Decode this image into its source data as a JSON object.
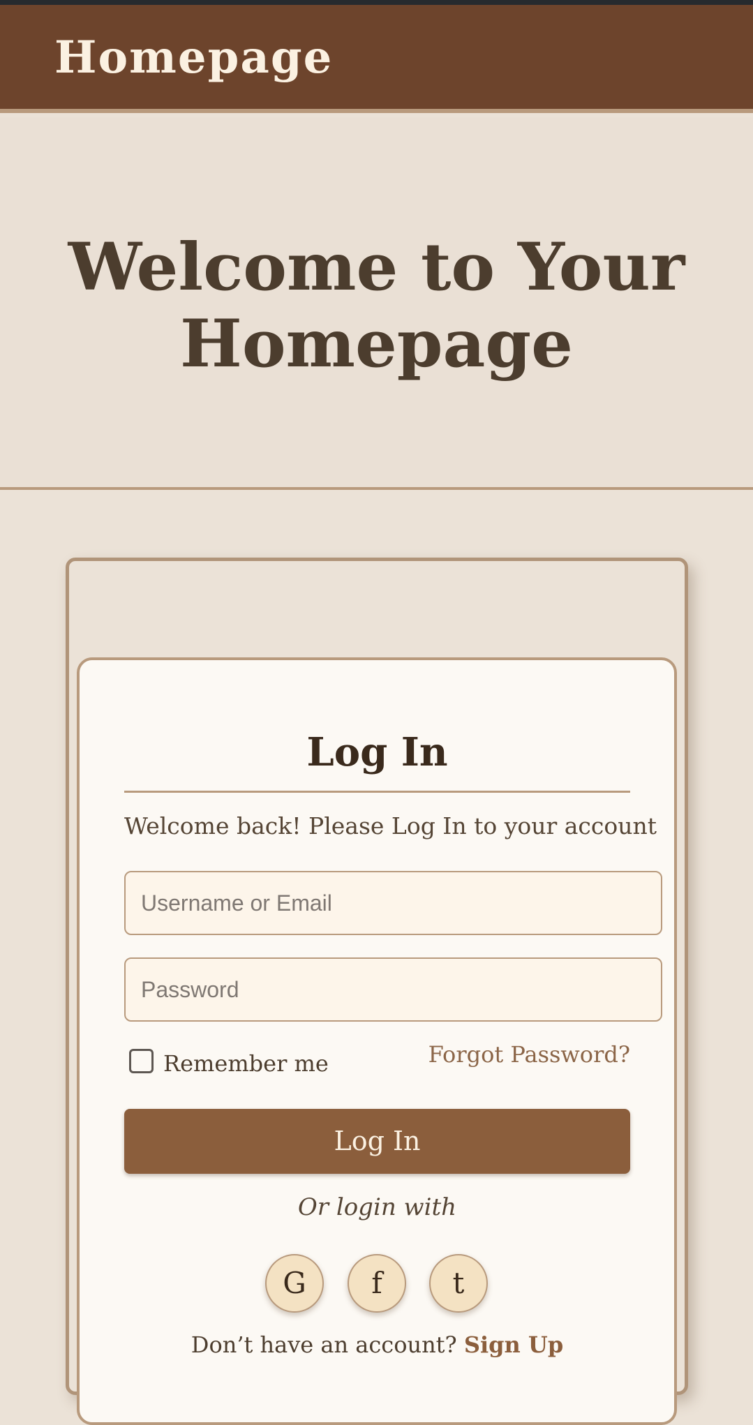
{
  "header": {
    "site_title": "Homepage"
  },
  "hero": {
    "title": "Welcome to Your Homepage"
  },
  "login": {
    "heading": "Log In",
    "welcome_text": "Welcome back! Please Log In to your account",
    "username_placeholder": "Username or Email",
    "username_value": "",
    "password_placeholder": "Password",
    "password_value": "",
    "remember_label": "Remember me",
    "remember_checked": false,
    "forgot_label": "Forgot Password?",
    "submit_label": "Log In",
    "alt_login_label": "Or login with",
    "social": [
      {
        "glyph": "G",
        "icon": "google-icon"
      },
      {
        "glyph": "f",
        "icon": "facebook-icon"
      },
      {
        "glyph": "t",
        "icon": "twitter-icon"
      }
    ],
    "signup_prompt": "Don’t have an account?",
    "signup_link": "Sign Up"
  },
  "colors": {
    "header_bg": "#6d442c",
    "page_bg": "#ebe2d7",
    "accent": "#8b5e3c",
    "border": "#b89a7d",
    "card_bg": "#fcf9f4",
    "input_bg": "#fdf5ea",
    "social_bg": "#f4e2c3"
  }
}
